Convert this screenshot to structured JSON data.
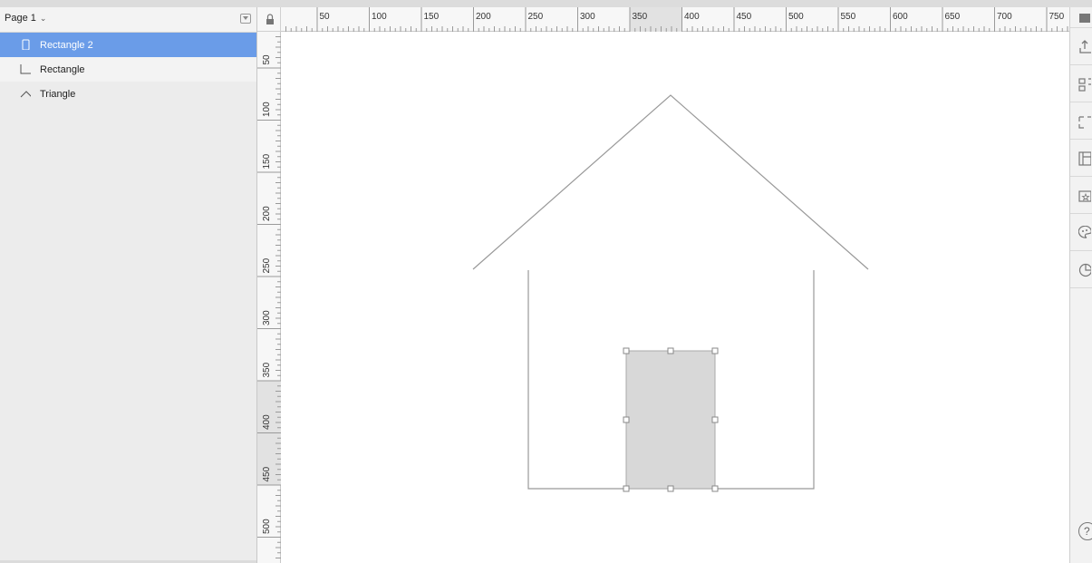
{
  "sidebar": {
    "page_selector": "Page 1",
    "layers": [
      {
        "label": "Rectangle 2",
        "icon": "rectangle-icon",
        "selected": true
      },
      {
        "label": "Rectangle",
        "icon": "open-rectangle-icon",
        "selected": false
      },
      {
        "label": "Triangle",
        "icon": "triangle-icon",
        "selected": false
      }
    ]
  },
  "rulers": {
    "horizontal_labels": [
      "50",
      "100",
      "150",
      "200",
      "250",
      "300",
      "350",
      "400",
      "450",
      "500",
      "550",
      "600",
      "650",
      "700",
      "750"
    ],
    "vertical_labels": [
      "50",
      "100",
      "150",
      "200",
      "250",
      "300",
      "350",
      "400",
      "450",
      "500"
    ],
    "highlight_h": [
      350,
      400
    ],
    "highlight_v": [
      350,
      450
    ]
  },
  "right_panel": {
    "icons": [
      "preview-icon",
      "export-icon",
      "align-icon",
      "transform-icon",
      "layout-icon",
      "symbols-icon",
      "styles-icon",
      "history-icon",
      "help-icon"
    ]
  },
  "colors": {
    "selection": "#6a9ce8",
    "shape_fill": "#d8d8d8",
    "stroke": "#999999"
  }
}
